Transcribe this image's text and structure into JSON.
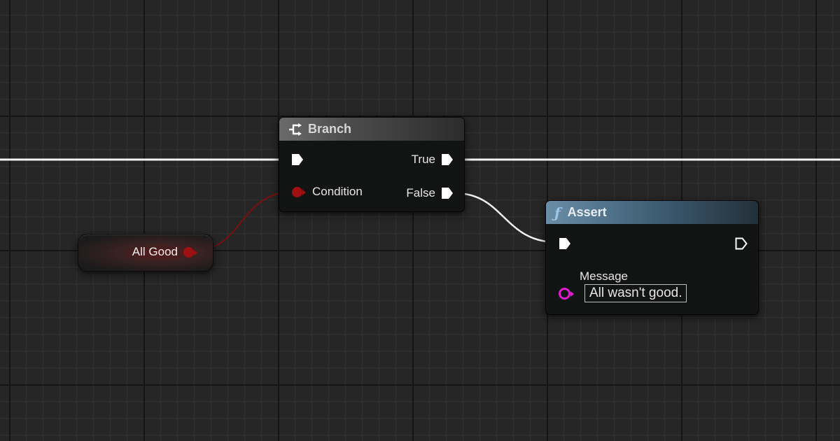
{
  "colors": {
    "exec_wire": "#f2f2f2",
    "bool_wire": "#7a0f0f",
    "bool_pin": "#a01010",
    "string_pin": "#e01bd1",
    "branch_header": "#5a5a5a",
    "assert_header": "#4f7188"
  },
  "variable_node": {
    "label": "All Good",
    "icon": "bool-pin-icon"
  },
  "branch_node": {
    "title": "Branch",
    "icon": "branch-icon",
    "condition_label": "Condition",
    "true_label": "True",
    "false_label": "False"
  },
  "assert_node": {
    "title": "Assert",
    "icon": "function-icon",
    "func_symbol": "ƒ",
    "message_label": "Message",
    "message_value": "All wasn't good."
  }
}
